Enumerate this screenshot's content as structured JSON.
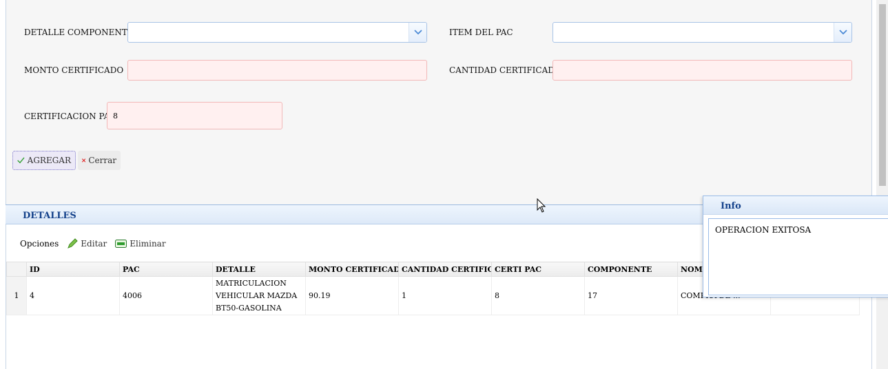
{
  "form": {
    "detalle_componente_label": "DETALLE COMPONENTE",
    "item_pac_label": "ITEM DEL PAC",
    "monto_certificado_label": "MONTO CERTIFICADO",
    "cantidad_certificado_label": "CANTIDAD CERTIFICADO",
    "certificacion_pac_label": "CERTIFICACION PAC",
    "certificacion_pac_value": "8",
    "monto_certificado_value": "",
    "cantidad_certificado_value": "",
    "detalle_componente_value": "",
    "item_pac_value": ""
  },
  "buttons": {
    "agregar": "AGREGAR",
    "cerrar": "Cerrar"
  },
  "panel": {
    "title": "DETALLES",
    "toolbar_label": "Opciones",
    "editar": "Editar",
    "eliminar": "Eliminar"
  },
  "grid": {
    "columns": [
      "",
      "ID",
      "PAC",
      "DETALLE",
      "MONTO CERTIFICADO",
      "CANTIDAD CERTIFICADO",
      "CERTI PAC",
      "COMPONENTE",
      "NOMBRE",
      ""
    ],
    "rows": [
      {
        "rownum": "1",
        "id": "4",
        "pac": "4006",
        "detalle_1": "MATRICULACION",
        "detalle_2": "VEHICULAR MAZDA",
        "detalle_3": "BT50-GASOLINA",
        "monto": "90.19",
        "cantidad": "1",
        "certi_pac": "8",
        "componente": "17",
        "nombre": "COMPRA DE ...",
        "extra": ""
      }
    ]
  },
  "info_popup": {
    "title": "Info",
    "message": "OPERACION EXITOSA"
  },
  "colors": {
    "accent_blue": "#15428b",
    "required_field_bg": "#fff0f0",
    "required_field_border": "#f2b8b8"
  }
}
